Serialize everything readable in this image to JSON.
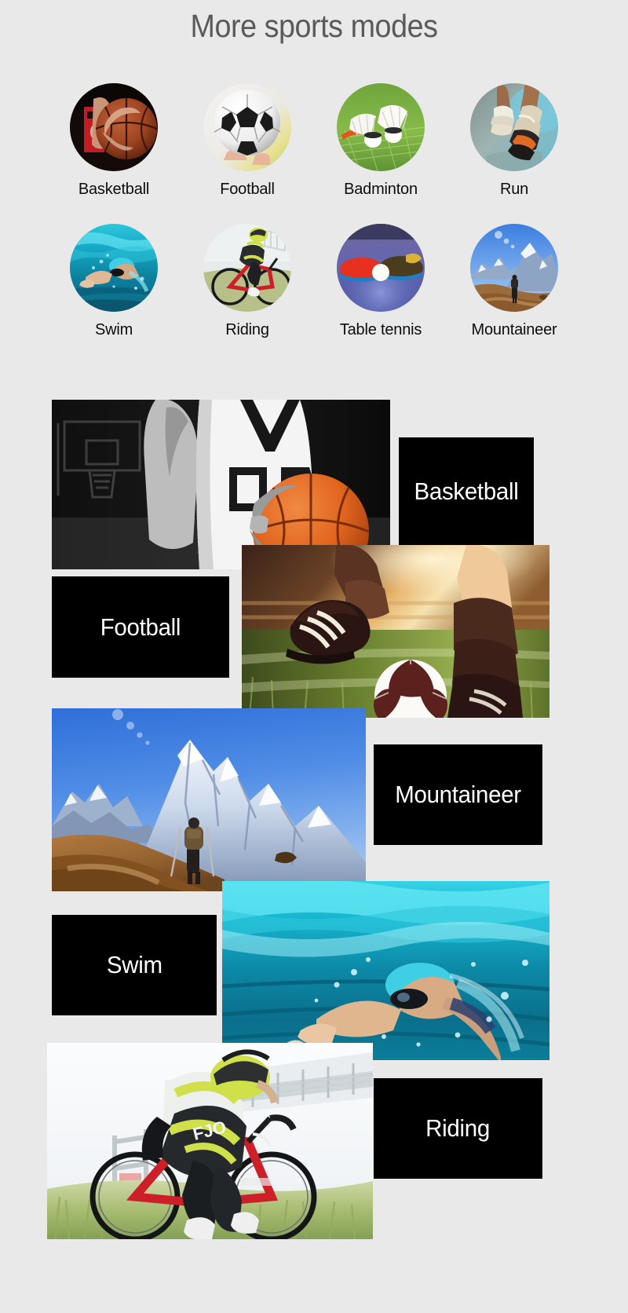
{
  "header": {
    "title": "More sports modes",
    "title_color": "#5a5a5a"
  },
  "theme": {
    "background": "#e9e9e9",
    "plate_background": "#000000",
    "plate_text": "#ffffff",
    "label_text": "#0d0d0d"
  },
  "modes_grid": {
    "rows": 2,
    "columns": 4,
    "items": [
      {
        "label": "Basketball",
        "icon": "basketball-circle-icon"
      },
      {
        "label": "Football",
        "icon": "football-circle-icon"
      },
      {
        "label": "Badminton",
        "icon": "badminton-circle-icon"
      },
      {
        "label": "Run",
        "icon": "run-circle-icon"
      },
      {
        "label": "Swim",
        "icon": "swim-circle-icon"
      },
      {
        "label": "Riding",
        "icon": "riding-circle-icon"
      },
      {
        "label": "Table tennis",
        "icon": "table-tennis-circle-icon"
      },
      {
        "label": "Mountaineer",
        "icon": "mountaineer-circle-icon"
      }
    ]
  },
  "banners": [
    {
      "label": "Basketball",
      "photo": "basketball-photo",
      "plate_side": "right"
    },
    {
      "label": "Football",
      "photo": "football-photo",
      "plate_side": "left"
    },
    {
      "label": "Mountaineer",
      "photo": "mountaineer-photo",
      "plate_side": "right"
    },
    {
      "label": "Swim",
      "photo": "swim-photo",
      "plate_side": "left"
    },
    {
      "label": "Riding",
      "photo": "riding-photo",
      "plate_side": "right"
    }
  ]
}
